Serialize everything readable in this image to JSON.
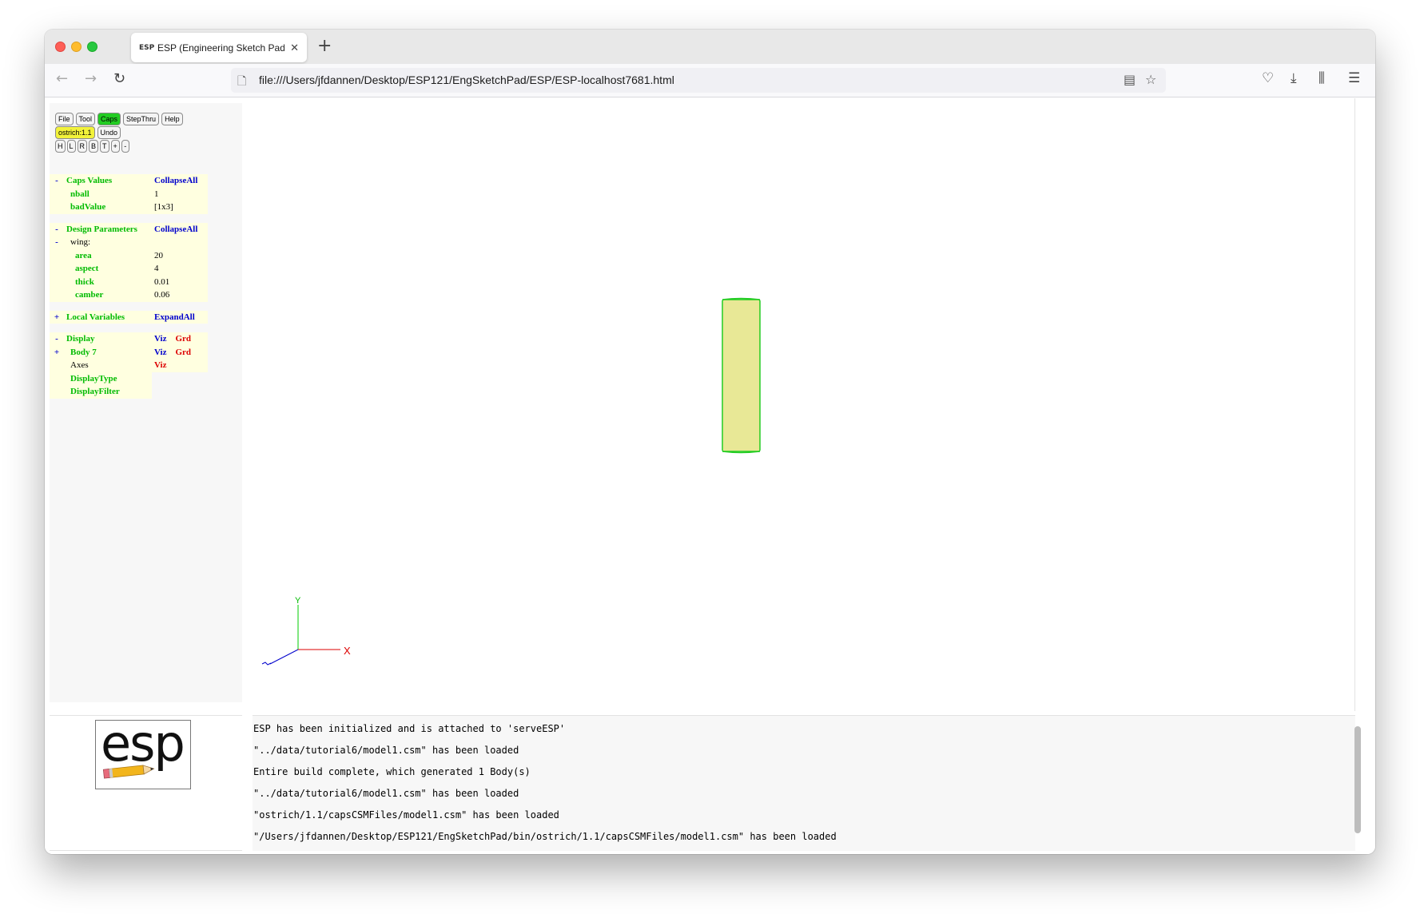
{
  "browser": {
    "tab_title": "ESP (Engineering Sketch Pad, V",
    "favicon": "ESP",
    "url": "file:///Users/jfdannen/Desktop/ESP121/EngSketchPad/ESP/ESP-localhost7681.html",
    "icons": [
      "back-icon",
      "forward-icon",
      "reload-icon",
      "page-icon",
      "reader-view-icon",
      "bookmark-star-icon",
      "pocket-icon",
      "download-icon",
      "library-icon",
      "menu-icon",
      "close-icon",
      "new-tab-icon"
    ]
  },
  "toolbar": {
    "row1": [
      "File",
      "Tool",
      "Caps",
      "StepThru",
      "Help"
    ],
    "row2": [
      "ostrich:1.1",
      "Undo"
    ],
    "row3": [
      "H",
      "L",
      "R",
      "B",
      "T",
      "+",
      "-"
    ]
  },
  "tree": {
    "caps": {
      "toggle": "-",
      "title": "Caps Values",
      "action": "CollapseAll"
    },
    "caps_items": [
      {
        "name": "nball",
        "value": "1"
      },
      {
        "name": "badValue",
        "value": "[1x3]"
      }
    ],
    "design": {
      "toggle": "-",
      "title": "Design Parameters",
      "action": "CollapseAll"
    },
    "wing": {
      "toggle": "-",
      "name": "wing:"
    },
    "design_items": [
      {
        "name": "area",
        "value": "20"
      },
      {
        "name": "aspect",
        "value": "4"
      },
      {
        "name": "thick",
        "value": "0.01"
      },
      {
        "name": "camber",
        "value": "0.06"
      }
    ],
    "local": {
      "toggle": "+",
      "title": "Local Variables",
      "action": "ExpandAll"
    },
    "display": {
      "toggle": "-",
      "title": "Display",
      "viz": "Viz",
      "grd": "Grd"
    },
    "body": {
      "toggle": "+",
      "name": "Body 7",
      "viz": "Viz",
      "grd": "Grd"
    },
    "axes": {
      "name": "Axes",
      "viz": "Viz"
    },
    "display_type": "DisplayType",
    "display_filter": "DisplayFilter"
  },
  "graphics": {
    "axis_x_label": "X",
    "axis_y_label": "Y",
    "body_fill": "#e8e896",
    "body_edge": "#22cc22"
  },
  "logo_text": "esp",
  "messages": [
    "ESP has been initialized and is attached to 'serveESP'",
    "\"../data/tutorial6/model1.csm\" has been loaded",
    "Entire build complete, which generated 1 Body(s)",
    "\"../data/tutorial6/model1.csm\" has been loaded",
    "\"ostrich/1.1/capsCSMFiles/model1.csm\" has been loaded",
    "\"/Users/jfdannen/Desktop/ESP121/EngSketchPad/bin/ostrich/1.1/capsCSMFiles/model1.csm\" has been loaded"
  ]
}
